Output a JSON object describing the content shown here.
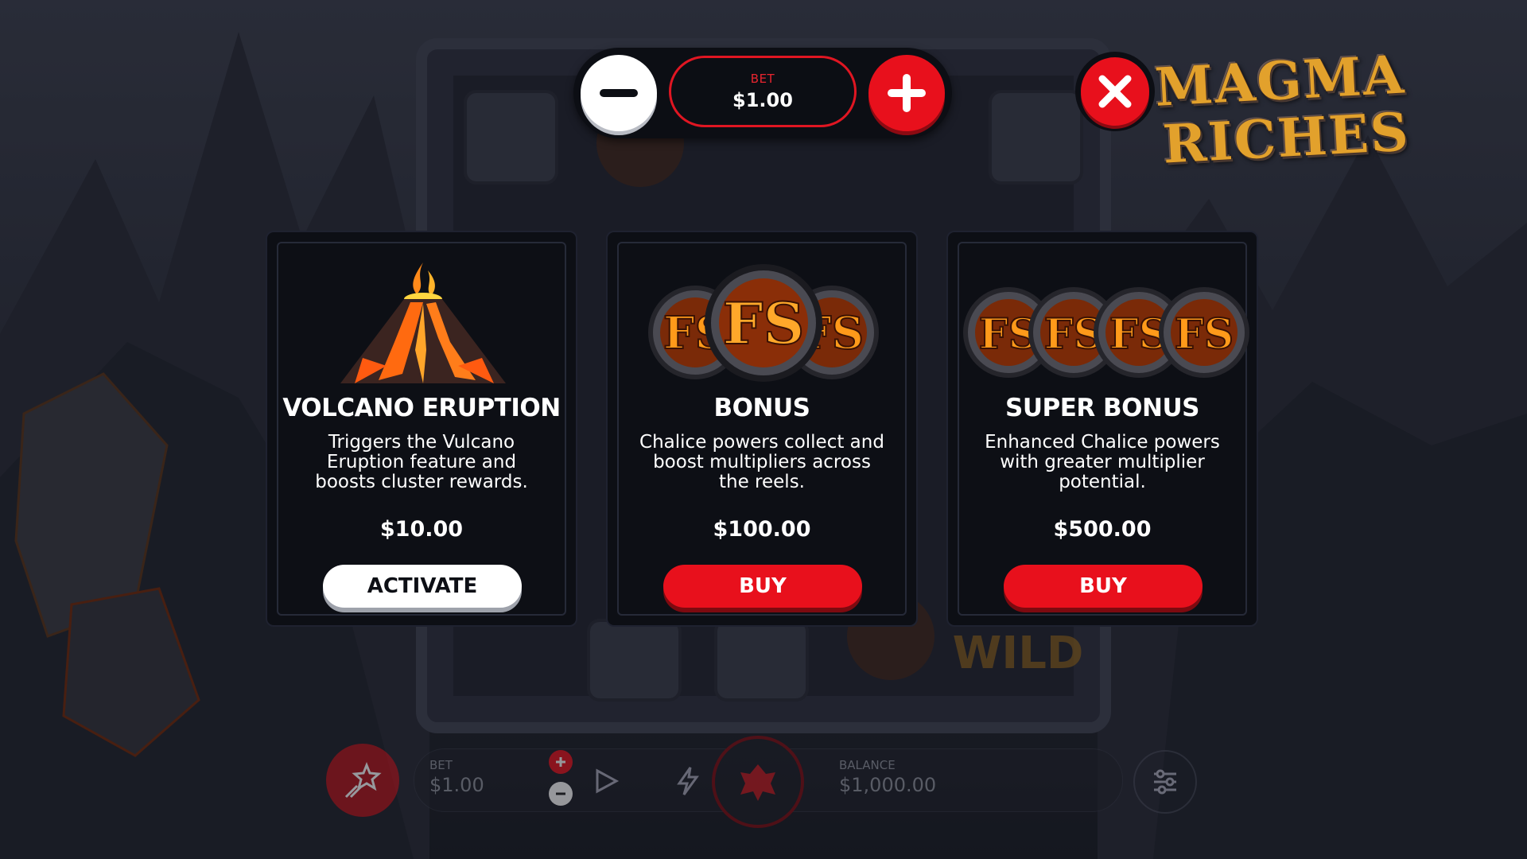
{
  "top_bar": {
    "bet_label": "BET",
    "bet_value": "$1.00"
  },
  "logo": {
    "line1": "MAGMA",
    "line2": "RICHES"
  },
  "cards": [
    {
      "icon": "volcano-icon",
      "title": "VOLCANO ERUPTION",
      "description": "Triggers the Vulcano Eruption feature and boosts cluster rewards.",
      "price": "$10.00",
      "button": "ACTIVATE"
    },
    {
      "icon": "fs-coins-icon",
      "title": "BONUS",
      "description": "Chalice powers collect and boost multipliers across the reels.",
      "price": "$100.00",
      "button": "BUY"
    },
    {
      "icon": "fs-coins-icon",
      "title": "SUPER BONUS",
      "description": "Enhanced Chalice powers with greater multiplier potential.",
      "price": "$500.00",
      "button": "BUY"
    }
  ],
  "coin_text": "FS",
  "bottom_bar": {
    "bet_label": "BET",
    "bet_value": "$1.00",
    "balance_label": "BALANCE",
    "balance_value": "$1,000.00"
  },
  "colors": {
    "accent_red": "#e8101c",
    "card_bg": "#0d0f15",
    "logo_gold": "#e2a12c"
  }
}
